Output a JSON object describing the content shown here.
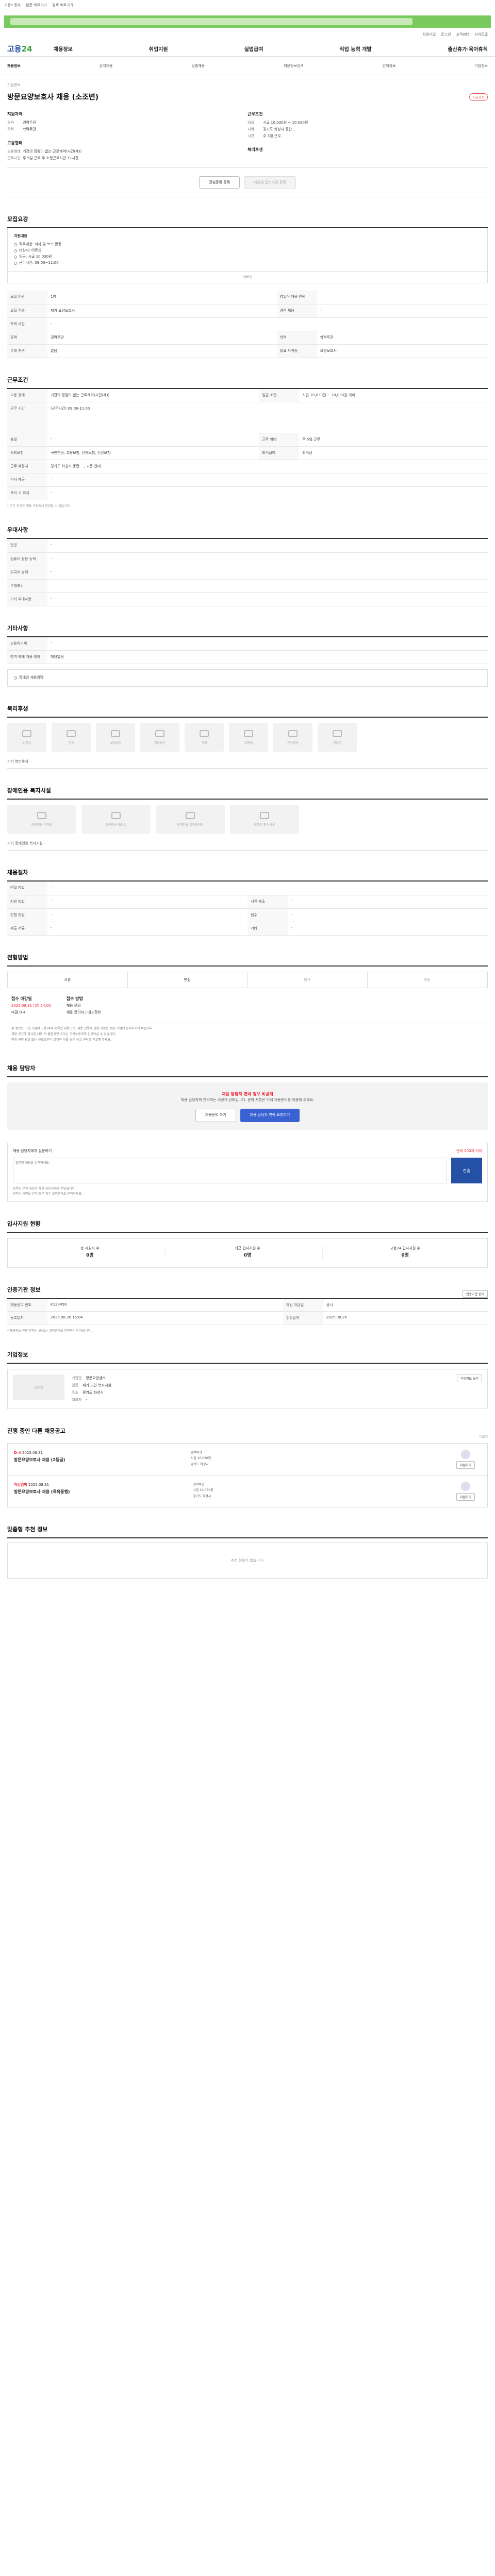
{
  "topbar": {
    "items": [
      "고용노동부",
      "본문 바로가기",
      "검색 바로가기"
    ]
  },
  "toplinks": [
    "회원가입",
    "로그인",
    "고객센터",
    "사이트맵"
  ],
  "gnb": {
    "logo_a": "고용",
    "logo_b": "24",
    "menu": [
      "채용정보",
      "취업지원",
      "실업급여",
      "직업 능력 개발",
      "출산휴가·육아휴직"
    ]
  },
  "subnav": [
    "채용정보",
    "공개채용",
    "맞춤채용",
    "채용정보검색",
    "인재정보",
    "기업정보"
  ],
  "job": {
    "company_label": "기업정보",
    "company": "기업명",
    "title": "방문요양보호사 채용 (소조변)",
    "badge": "시급관련",
    "left_head": "지원자격",
    "left_rows": [
      [
        "경력",
        "경력무관"
      ],
      [
        "학력",
        "학력무관"
      ]
    ],
    "right_head": "근무조건",
    "right_rows": [
      [
        "임금",
        "시급 10,030원 ~ 10,030원"
      ],
      [
        "지역",
        "경기도 화성시 동탄 ..."
      ],
      [
        "시간",
        "주 5일 근무"
      ]
    ],
    "left_head2": "고용형태",
    "left_rows2": [
      [
        "고용형태",
        "기간의 정함이 없는 근로계약(시간(제))"
      ],
      [
        "근무시간",
        "주 5일 근무 주 소정근로시간 11시간"
      ]
    ],
    "right_head2": "복리후생"
  },
  "actions": [
    "관심등록 등록",
    "다른일 입사지원 등록"
  ],
  "s_content": {
    "title": "모집요강",
    "bh": "지원내용",
    "rows": [
      "직무내용: 식사 및 보조 활동",
      "대상자: 어르신",
      "임금: 시급 10,030원",
      "근무시간: 09:00~11:00"
    ],
    "more": "더보기"
  },
  "s_table1": [
    [
      "모집 인원",
      "1명",
      "영업직 채용 인원",
      "-"
    ],
    [
      "모집 직종",
      "재가 요양보호사",
      "경력 채용",
      "-"
    ],
    [
      "학력 사항",
      "-",
      "",
      ""
    ],
    [
      "경력",
      "경력무관",
      "학력",
      "학력무관"
    ],
    [
      "우대 자격",
      "없음",
      "필요 자격증",
      "요양보호사"
    ]
  ],
  "s_work": {
    "title": "근무조건",
    "rows": [
      [
        "고용 형태",
        "기간의 정함이 없는 근로계약(시간(제))",
        "임금 조건",
        "시급 10,030원 ~ 10,030원 이하"
      ],
      [
        "근무 시간",
        "(근무시간) 09:00-11:00",
        "",
        ""
      ],
      [
        "휴일",
        "-",
        "근무 형태",
        "주 5일 근무"
      ],
      [
        "사회보험",
        "국민연금, 고용보험, 산재보험, 건강보험",
        "퇴직급여",
        "퇴직금"
      ],
      [
        "근무 예정지",
        "경기도 화성시 동탄 ..., 교통 안내",
        "",
        ""
      ],
      [
        "식사 제공",
        "-",
        "",
        ""
      ],
      [
        "복리 시 위치",
        "-",
        "",
        ""
      ]
    ],
    "note": "* 근무 조건은 채용 과정에서 변경될 수 있습니다."
  },
  "s_pref": {
    "title": "우대사항",
    "rows": [
      [
        "전공",
        "-"
      ],
      [
        "컴퓨터 활용 능력",
        "-"
      ],
      [
        "외국어 능력",
        "-"
      ],
      [
        "우대조건",
        "-"
      ],
      [
        "기타 우대사항",
        "-"
      ]
    ]
  },
  "s_etc": {
    "title": "기타사항",
    "rows": [
      [
        "고용허가제",
        "-"
      ],
      [
        "병역 특례 채용 희망",
        "해당없음"
      ]
    ],
    "check": "장애인 채용희망"
  },
  "s_welfare": {
    "title": "복리후생",
    "items": [
      "퇴직금",
      "연차",
      "4대보험",
      "경조휴가",
      "식비",
      "교통비",
      "간식제공",
      "경조금"
    ],
    "etc_label": "기타 복리후생",
    "etc": "-"
  },
  "s_disab": {
    "title": "장애인용 복지시설",
    "items": [
      "장애인용 주차장",
      "장애인용 화장실",
      "장애인용 엘리베이터",
      "장애인 편의시설"
    ],
    "etc_label": "기타 장애인용 복지시설",
    "etc": "-"
  },
  "s_hire": {
    "title": "채용절차",
    "rows": [
      [
        "면접 방법",
        "-"
      ],
      [
        "지원 방법",
        "-",
        "서류 제출",
        "-"
      ],
      [
        "전형 방법",
        "-",
        "접수",
        "-"
      ],
      [
        "제출 서류",
        "-",
        "기타",
        "-"
      ]
    ]
  },
  "s_process": {
    "title": "전형방법",
    "steps": [
      "서류",
      "면접",
      "합격",
      "최종"
    ],
    "c1h": "접수 마감일",
    "c1": "2025.08.31 (일) 24:00",
    "c1s": "마감 D-4",
    "c2h": "접수 방법",
    "c2": "채용 문의",
    "c2b": "채용 문의처 / 대표전화",
    "bullets": [
      "본 정보는 구인 기업이 고용24에 등록한 내용으로, 채용 진행에 관한 사항은 해당 기업에 문의하시기 바랍니다.",
      "채용 공고에 명시된 내용 외 불합리한 처우는 고용노동부에 신고하실 수 있습니다.",
      "허위 구인 광고 또는 근로조건이 실제와 다를 경우 신고 센터로 신고해 주세요."
    ]
  },
  "s_contact": {
    "title": "채용 담당자",
    "alert_t": "채용 담당자 연락 정보 비공개",
    "alert": "채용 담당자의 연락처는 비공개 상태입니다. 문의 사항은 아래 채용문의를 이용해 주세요.",
    "b1": "채용문의 하기",
    "b2": "채용 담당자 연락 요청하기",
    "qna_h": "채용 담당자에게 질문하기",
    "qna_r": "문의 500자 이내",
    "qna_ph": "질문할 내용을 입력하세요.",
    "send": "전송",
    "qna_n": [
      "등록된 문의 내용은 채용 담당자에게 전달됩니다.",
      "원하는 답변을 받지 못한 경우 고객센터로 문의하세요."
    ]
  },
  "s_status": {
    "title": "입사지원 현황",
    "a": "총 지원자 수",
    "av": "0명",
    "b": "최근 입사지원 수",
    "bv": "0명",
    "c": "고용24 입사지원 수",
    "cv": "0명"
  },
  "s_info": {
    "title": "인증기관 정보",
    "btn": "인증기관 문의",
    "rows": [
      [
        "채용공고 번호",
        "K123456",
        "지원 마감일",
        "상시"
      ],
      [
        "등록일자",
        "2025.08.26 15:04",
        "수정일자",
        "2025.08.26"
      ]
    ],
    "note": "* 채용정보 관련 문의는 고용24 고객센터로 연락하시기 바랍니다."
  },
  "s_company": {
    "title": "기업정보",
    "logo": "LOGO",
    "rows": [
      [
        "기업명",
        "방문요양센터"
      ],
      [
        "업종",
        "재가 노인 복지시설"
      ],
      [
        "주소",
        "경기도 화성시"
      ],
      [
        "대표자",
        "-"
      ]
    ],
    "btn": "기업정보 보기"
  },
  "s_other": {
    "title": "진행 중인 다른 채용공고",
    "more": "더보기",
    "cards": [
      {
        "dday": "D-4",
        "t": "방문요양보호사 채용 (2등급)",
        "sub": "2025.08.31",
        "m": [
          "경력무관",
          "시급 10,030원",
          "경기도 화성시"
        ],
        "btn": "지원하기"
      },
      {
        "dday": "마감임박",
        "t": "방문요양보호사 채용 (목욕동행)",
        "sub": "2025.08.31",
        "m": [
          "경력무관",
          "시급 10,030원",
          "경기도 화성시"
        ],
        "btn": "지원하기"
      }
    ]
  },
  "s_rec": {
    "title": "맞춤형 추천 정보",
    "empty": "추천 정보가 없습니다."
  }
}
